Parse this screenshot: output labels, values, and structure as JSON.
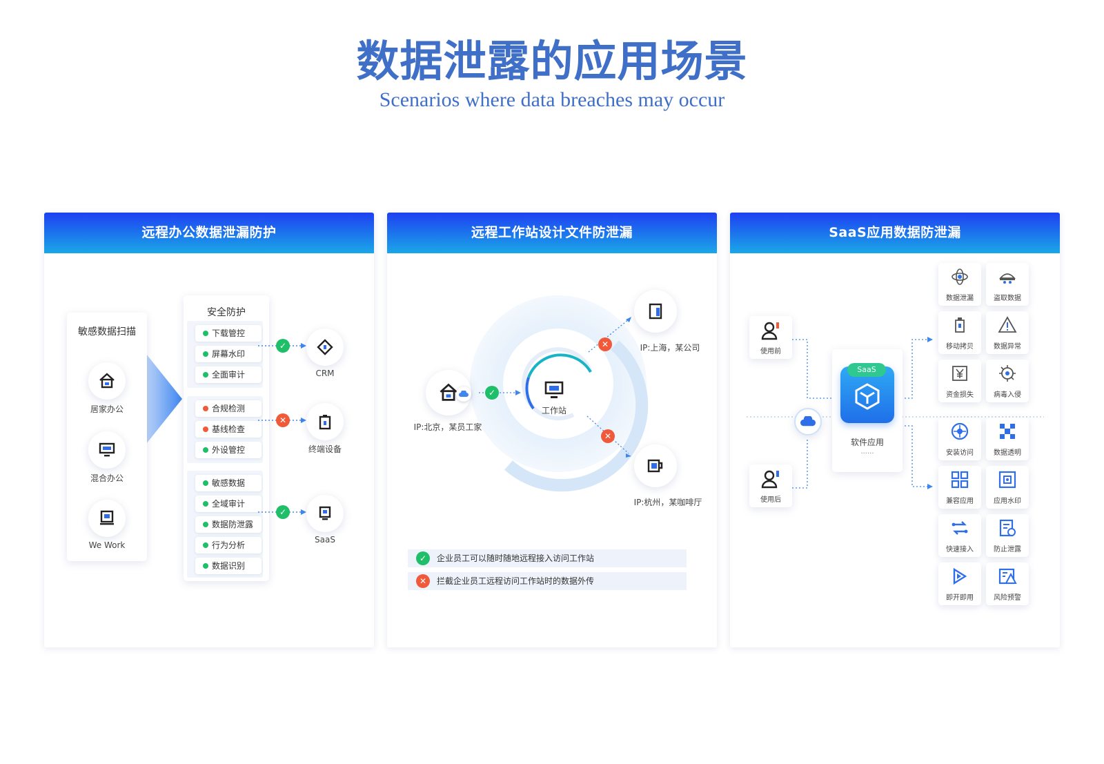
{
  "title": "数据泄露的应用场景",
  "subtitle": "Scenarios where data breaches may occur",
  "colors": {
    "accent": "#3f6fc7",
    "header_from": "#1e40f2",
    "header_to": "#1aa7e8",
    "ok": "#1fbf6a",
    "bad": "#f05a3a"
  },
  "panel1": {
    "title": "远程办公数据泄漏防护",
    "scan_title": "敏感数据扫描",
    "sources": [
      {
        "label": "居家办公",
        "icon": "home-icon"
      },
      {
        "label": "混合办公",
        "icon": "monitor-icon"
      },
      {
        "label": "We Work",
        "icon": "workstation-icon"
      }
    ],
    "protect_title": "安全防护",
    "groups": [
      {
        "items": [
          "下载管控",
          "屏幕水印",
          "全面审计"
        ]
      },
      {
        "items": [
          "合规检测",
          "基线检查",
          "外设管控"
        ]
      },
      {
        "items": [
          "敏感数据",
          "全域审计",
          "数据防泄露",
          "行为分析",
          "数据识别"
        ]
      }
    ],
    "targets": [
      {
        "label": "CRM",
        "icon": "crm-icon",
        "status": "allowed"
      },
      {
        "label": "终端设备",
        "icon": "device-icon",
        "status": "blocked"
      },
      {
        "label": "SaaS",
        "icon": "saas-icon",
        "status": "allowed"
      }
    ]
  },
  "panel2": {
    "title": "远程工作站设计文件防泄漏",
    "center_label": "工作站",
    "beijing_label": "IP:北京，某员工家",
    "shanghai_label": "IP:上海，某公司",
    "hangzhou_label": "IP:杭州，某咖啡厅",
    "legend": [
      {
        "status": "allowed",
        "text": "企业员工可以随时随地远程接入访问工作站"
      },
      {
        "status": "blocked",
        "text": "拦截企业员工远程访问工作站时的数据外传"
      }
    ]
  },
  "panel3": {
    "title": "SaaS应用数据防泄漏",
    "before_label": "使用前",
    "after_label": "使用后",
    "saas_badge": "SaaS",
    "app_label": "软件应用",
    "app_more": "......",
    "risks": [
      {
        "label": "数据泄漏",
        "icon": "leak-icon"
      },
      {
        "label": "盗取数据",
        "icon": "thief-icon"
      },
      {
        "label": "移动拷贝",
        "icon": "usb-copy-icon"
      },
      {
        "label": "数据异常",
        "icon": "warning-icon"
      },
      {
        "label": "资金损失",
        "icon": "money-loss-icon"
      },
      {
        "label": "病毒入侵",
        "icon": "virus-icon"
      }
    ],
    "benefits": [
      {
        "label": "安装访问",
        "icon": "install-access-icon"
      },
      {
        "label": "数据透明",
        "icon": "data-transparent-icon"
      },
      {
        "label": "兼容应用",
        "icon": "compatible-apps-icon"
      },
      {
        "label": "应用水印",
        "icon": "app-watermark-icon"
      },
      {
        "label": "快速接入",
        "icon": "quick-access-icon"
      },
      {
        "label": "防止泄露",
        "icon": "prevent-leak-icon"
      },
      {
        "label": "即开即用",
        "icon": "instant-use-icon"
      },
      {
        "label": "风险预警",
        "icon": "risk-alert-icon"
      }
    ]
  }
}
